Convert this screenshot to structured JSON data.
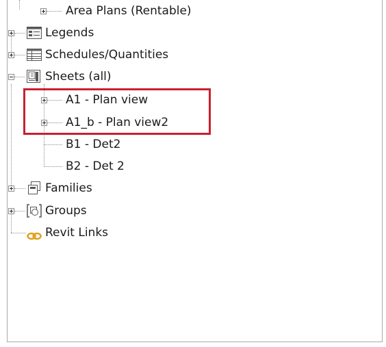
{
  "tree": {
    "items": [
      {
        "label": "Area Plans (Rentable)",
        "expander": "plus",
        "icon": "none"
      },
      {
        "label": "Legends",
        "expander": "plus",
        "icon": "legend-icon"
      },
      {
        "label": "Schedules/Quantities",
        "expander": "plus",
        "icon": "schedule-icon"
      },
      {
        "label": "Sheets (all)",
        "expander": "minus",
        "icon": "sheet-icon"
      },
      {
        "label": "A1 - Plan view",
        "expander": "plus",
        "icon": "none"
      },
      {
        "label": "A1_b - Plan view2",
        "expander": "plus",
        "icon": "none"
      },
      {
        "label": "B1 - Det2",
        "expander": "none",
        "icon": "none"
      },
      {
        "label": "B2 - Det 2",
        "expander": "none",
        "icon": "none"
      },
      {
        "label": "Families",
        "expander": "plus",
        "icon": "families-icon"
      },
      {
        "label": "Groups",
        "expander": "plus",
        "icon": "groups-icon"
      },
      {
        "label": "Revit Links",
        "expander": "none",
        "icon": "revit-links-icon"
      }
    ]
  },
  "colors": {
    "highlight_border": "#c8202f",
    "revit_link_icon": "#e0a020"
  }
}
